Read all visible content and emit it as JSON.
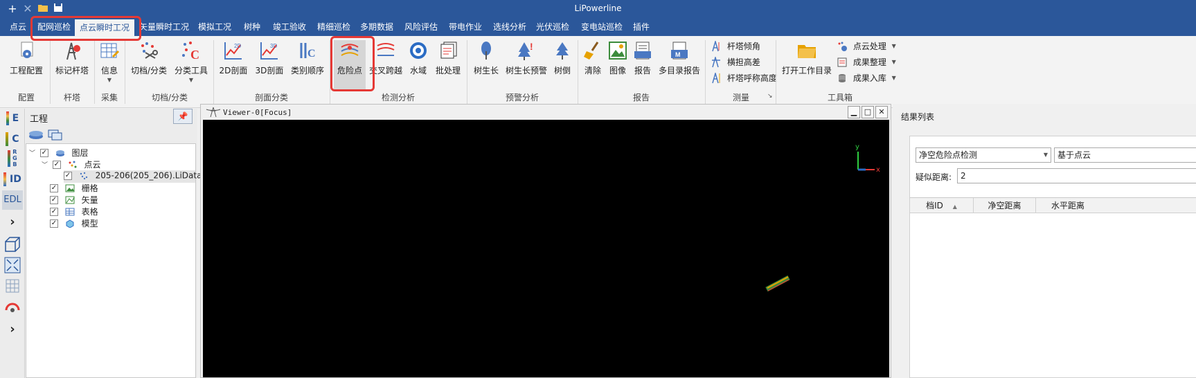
{
  "app": {
    "title": "LiPowerline"
  },
  "quick_access": [
    "add-icon",
    "close-icon",
    "folder-icon",
    "save-icon"
  ],
  "menu": {
    "tabs": [
      {
        "label": "点云"
      },
      {
        "label": "配网巡检"
      },
      {
        "label": "点云瞬时工况",
        "active": true
      },
      {
        "label": "矢量瞬时工况"
      },
      {
        "label": "模拟工况"
      },
      {
        "label": "树种"
      },
      {
        "label": "竣工验收"
      },
      {
        "label": "精细巡检"
      },
      {
        "label": "多期数据"
      },
      {
        "label": "风险评估"
      },
      {
        "label": "带电作业"
      },
      {
        "label": "选线分析"
      },
      {
        "label": "光伏巡检"
      },
      {
        "label": "变电站巡检"
      },
      {
        "label": "插件"
      }
    ]
  },
  "ribbon": {
    "groups": [
      "配置",
      "杆塔",
      "采集",
      "切档/分类",
      "剖面分类",
      "检测分析",
      "预警分析",
      "报告",
      "测量",
      "工具箱"
    ],
    "buttons": {
      "project_config": "工程配置",
      "mark_tower": "标记杆塔",
      "info": "信息",
      "cut_classify": "切档/分类",
      "classify_tool": "分类工具",
      "profile_2d": "2D剖面",
      "profile_3d": "3D剖面",
      "class_order": "类别顺序",
      "danger_point": "危险点",
      "cross_span": "交叉跨越",
      "water_area": "水域",
      "batch": "批处理",
      "tree_growth": "树生长",
      "tree_growth_warning": "树生长预警",
      "tree_fall": "树倒",
      "clear": "清除",
      "image": "图像",
      "report": "报告",
      "multi_dir_report": "多目录报告",
      "open_workdir": "打开工作目录"
    },
    "measure": {
      "tower_tilt": "杆塔倾角",
      "cross_arm_diff": "横担高差",
      "tower_nominal_height": "杆塔呼称高度"
    },
    "toolbox": {
      "pointcloud_process": "点云处理",
      "result_organize": "成果整理",
      "result_storage": "成果入库"
    },
    "icon_labels": {
      "profile_2d": "2D",
      "profile_3d": "3D",
      "class_order": "C"
    }
  },
  "left_tools": {
    "e": "E",
    "c": "C",
    "rgb": "R G B",
    "id": "ID",
    "edl": "EDL",
    "more": "›"
  },
  "project": {
    "title": "工程",
    "tree": [
      {
        "label": "图层",
        "level": 0,
        "expanded": true,
        "checked": true
      },
      {
        "label": "点云",
        "level": 1,
        "expanded": true,
        "checked": true
      },
      {
        "label": "205-206(205_206).LiData",
        "level": 2,
        "checked": true,
        "selected": true
      },
      {
        "label": "栅格",
        "level": 1,
        "checked": true
      },
      {
        "label": "矢量",
        "level": 1,
        "checked": true
      },
      {
        "label": "表格",
        "level": 1,
        "checked": true
      },
      {
        "label": "模型",
        "level": 1,
        "checked": true
      }
    ]
  },
  "viewer": {
    "title": "Viewer-0[Focus]",
    "axis_y": "y",
    "axis_x": "x"
  },
  "results": {
    "title": "结果列表",
    "detect_type": "净空危险点检测",
    "based_on": "基于点云",
    "suspect_label": "疑似距离:",
    "suspect_value": "2",
    "columns": [
      "档ID",
      "净空距离",
      "水平距离"
    ]
  },
  "colors": {
    "titlebar": "#2b579a",
    "highlight": "#e53935",
    "canvas": "#000000"
  }
}
